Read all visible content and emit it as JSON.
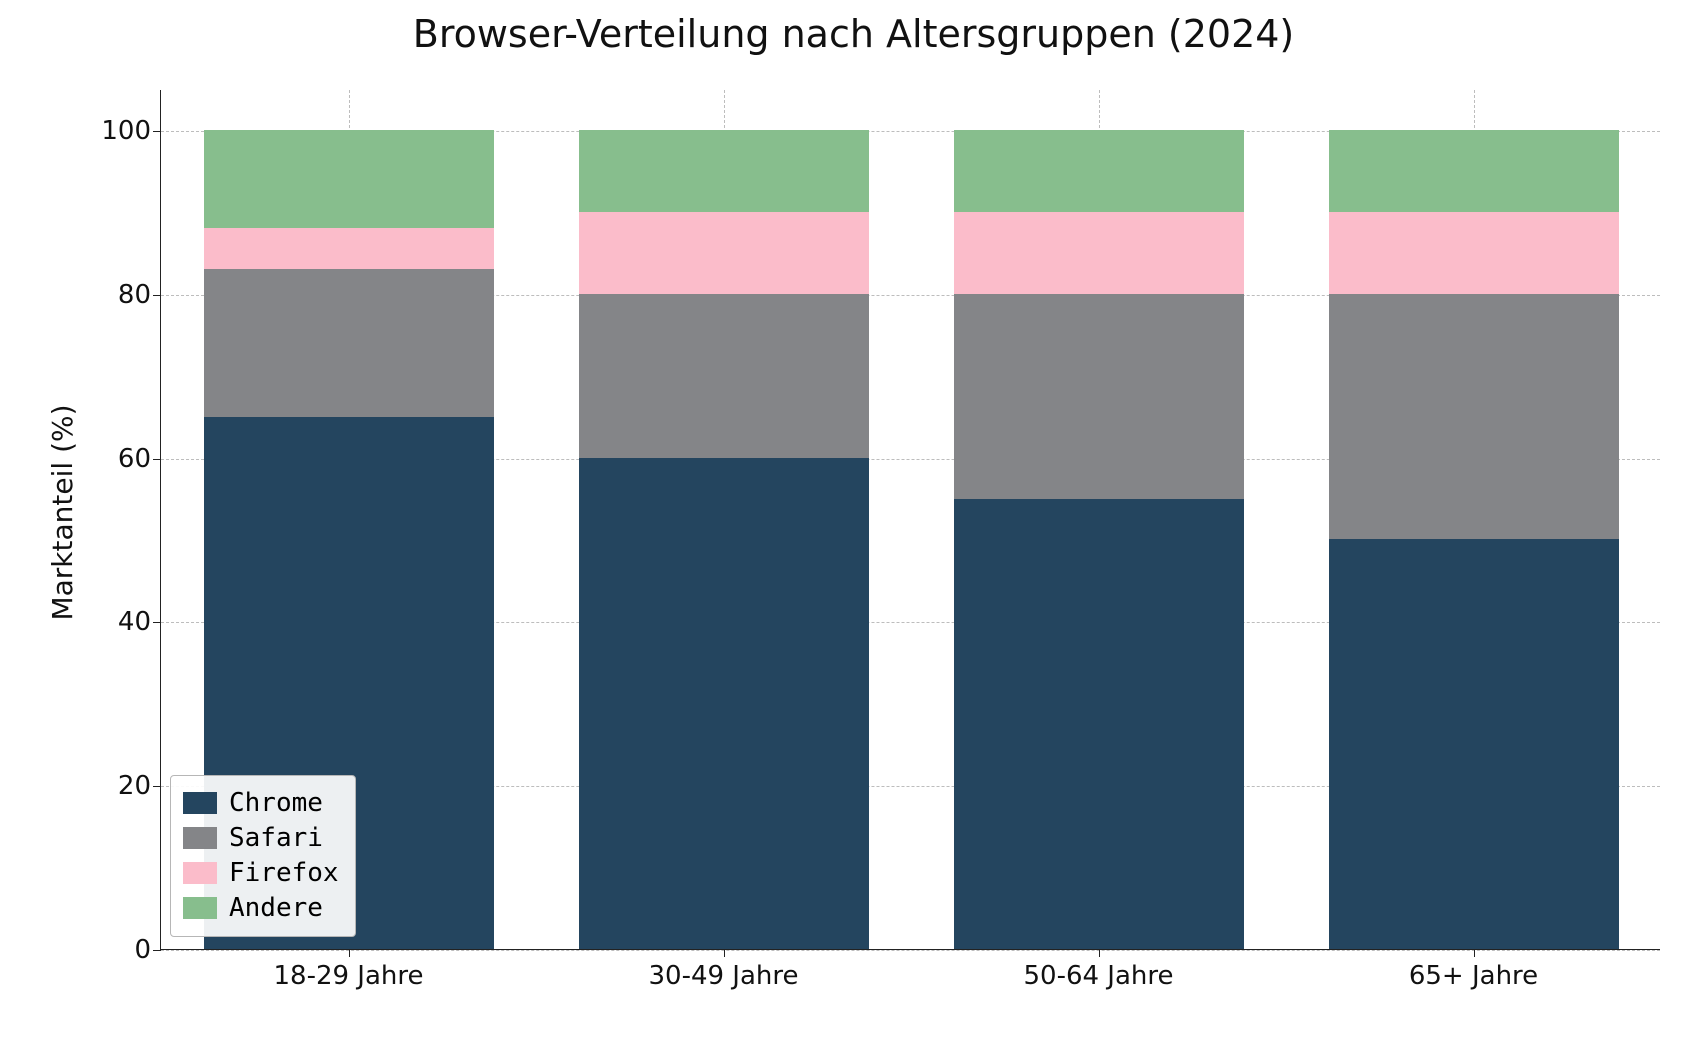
{
  "chart_data": {
    "type": "bar",
    "stacked": true,
    "title": "Browser-Verteilung nach Altersgruppen (2024)",
    "xlabel": "",
    "ylabel": "Marktanteil (%)",
    "ylim": [
      0,
      105
    ],
    "yticks": [
      0,
      20,
      40,
      60,
      80,
      100
    ],
    "categories": [
      "18-29 Jahre",
      "30-49 Jahre",
      "50-64 Jahre",
      "65+ Jahre"
    ],
    "series": [
      {
        "name": "Chrome",
        "color": "#24455f",
        "values": [
          65,
          60,
          55,
          50
        ]
      },
      {
        "name": "Safari",
        "color": "#848588",
        "values": [
          18,
          20,
          25,
          30
        ]
      },
      {
        "name": "Firefox",
        "color": "#fbbcca",
        "values": [
          5,
          10,
          10,
          10
        ]
      },
      {
        "name": "Andere",
        "color": "#87be8d",
        "values": [
          12,
          10,
          10,
          10
        ]
      }
    ],
    "legend_position": "lower left",
    "grid": true
  }
}
